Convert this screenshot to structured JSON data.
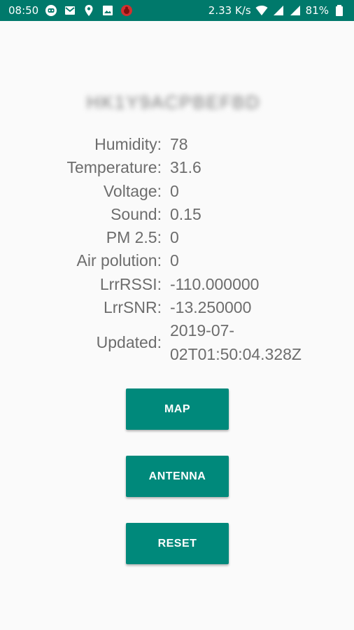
{
  "status_bar": {
    "time": "08:50",
    "net_speed": "2.33 K/s",
    "battery": "81%",
    "left_icons": [
      "robot-icon",
      "mail-icon",
      "location-icon",
      "image-icon",
      "bug-icon"
    ],
    "right_icons": [
      "wifi-icon",
      "signal-icon",
      "signal-icon",
      "battery-icon"
    ]
  },
  "device": {
    "name_blurred": "HK1Y9ACPBEFBD"
  },
  "readings": [
    {
      "label": "Humidity:",
      "value": "78"
    },
    {
      "label": "Temperature:",
      "value": "31.6"
    },
    {
      "label": "Voltage:",
      "value": "0"
    },
    {
      "label": "Sound:",
      "value": "0.15"
    },
    {
      "label": "PM 2.5:",
      "value": "0"
    },
    {
      "label": "Air polution:",
      "value": "0"
    },
    {
      "label": "LrrRSSI:",
      "value": "-110.000000"
    },
    {
      "label": "LrrSNR:",
      "value": "-13.250000"
    },
    {
      "label": "Updated:",
      "value_line1": "2019-07-",
      "value_line2": "02T01:50:04.328Z"
    }
  ],
  "buttons": {
    "map": "MAP",
    "antenna": "ANTENNA",
    "reset": "RESET"
  },
  "colors": {
    "status_bar": "#00796b",
    "button": "#00897b",
    "background": "#fafafa",
    "text": "#6d6d6d"
  }
}
